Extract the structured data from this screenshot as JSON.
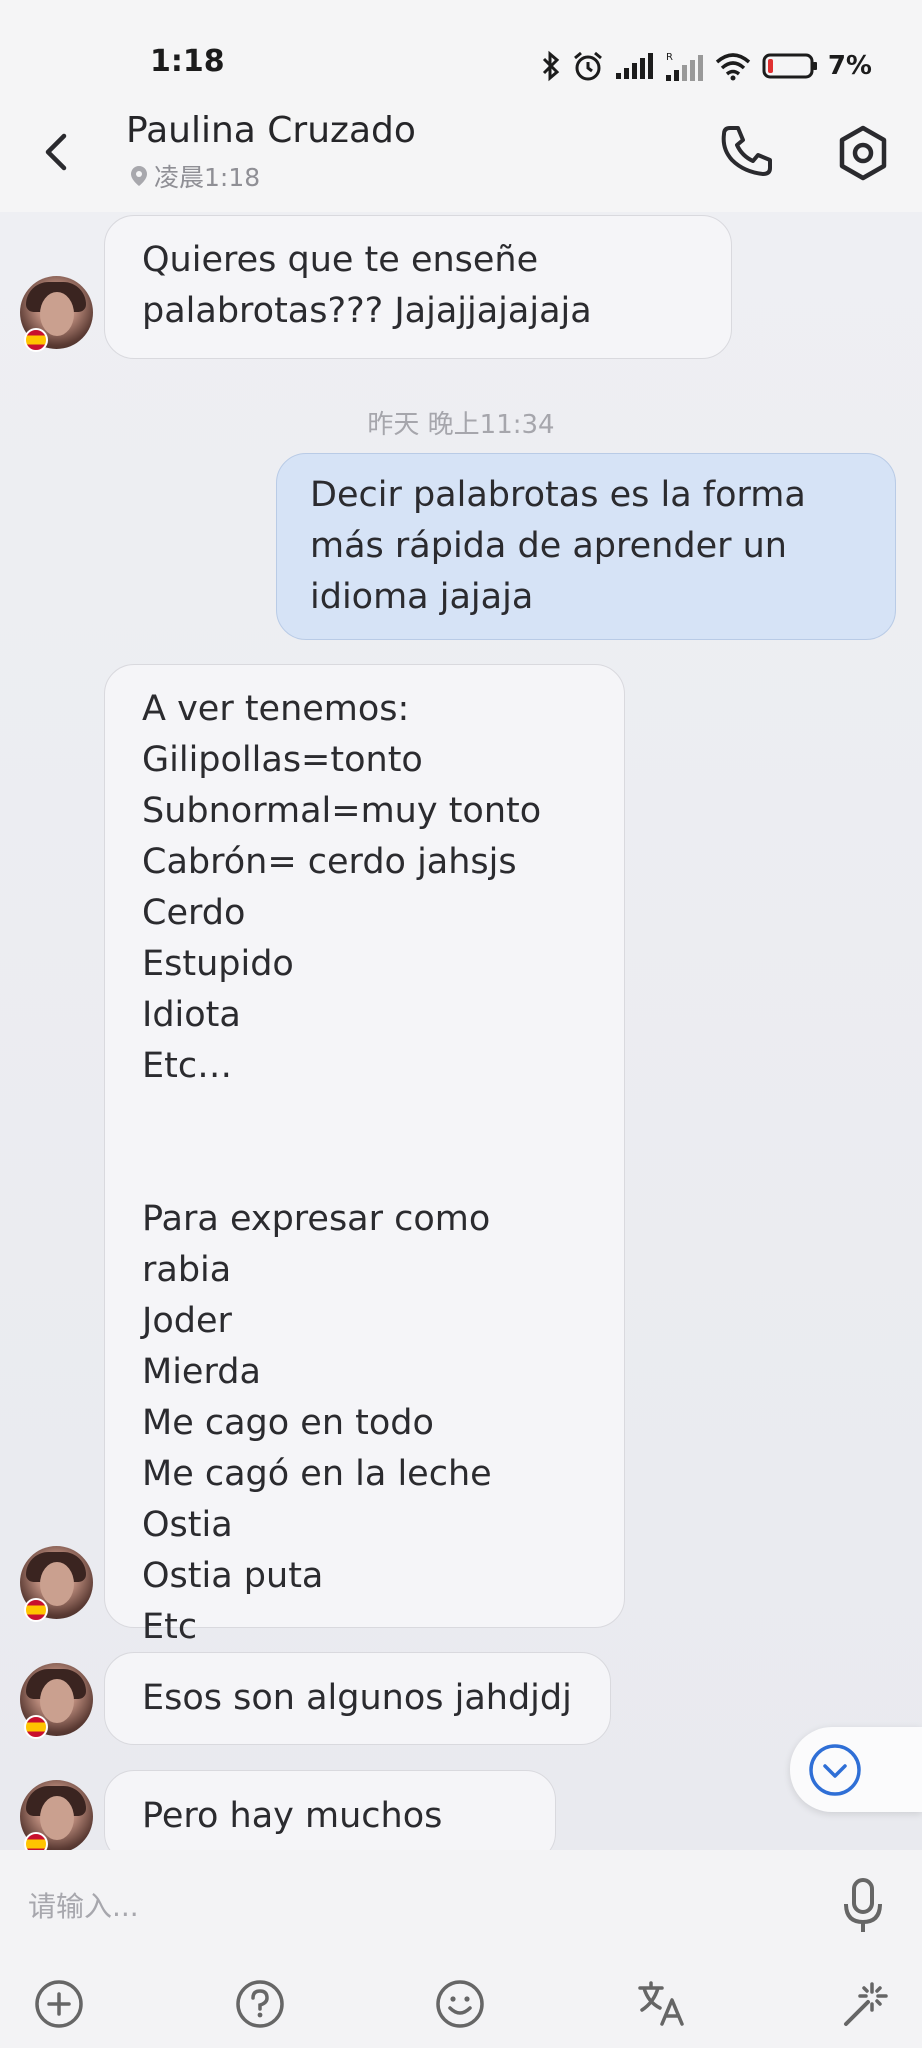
{
  "status_bar": {
    "time": "1:18",
    "battery": "7%"
  },
  "header": {
    "contact_name": "Paulina Cruzado",
    "subtitle": "凌晨1:18"
  },
  "messages": [
    {
      "direction": "incoming",
      "text": "Quieres que te enseñe\npalabrotas??? Jajajjajajaja"
    },
    {
      "direction": "outgoing",
      "text": "Decir palabrotas es la forma\nmás rápida de aprender un\nidioma jajaja"
    },
    {
      "direction": "incoming",
      "text": "A ver tenemos:\nGilipollas=tonto\nSubnormal=muy tonto\nCabrón= cerdo jahsjs\nCerdo\nEstupido\nIdiota\nEtc…\n\n\nPara expresar como rabia\nJoder\nMierda\nMe cago en todo\nMe cagó en la leche\nOstia\nOstia puta\nEtc"
    },
    {
      "direction": "incoming",
      "text": "Esos son algunos jahdjdj"
    },
    {
      "direction": "incoming",
      "text": "Pero hay muchos mas"
    }
  ],
  "timestamp": "昨天 晚上11:34",
  "input": {
    "placeholder": "请输入..."
  },
  "colors": {
    "outgoing_bubble": "#d6e3f6",
    "incoming_bubble": "#f5f5f8",
    "accent": "#2f6fd6"
  },
  "icons": [
    "back-icon",
    "phone-icon",
    "settings-icon",
    "location-pin-icon",
    "chevron-down-icon",
    "mic-icon",
    "plus-icon",
    "question-icon",
    "emoji-icon",
    "translate-icon",
    "magic-icon"
  ]
}
